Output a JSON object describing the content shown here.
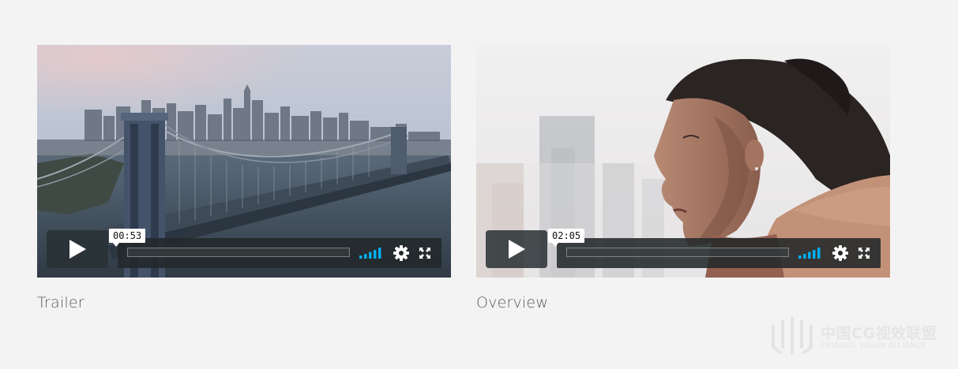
{
  "videos": [
    {
      "caption": "Trailer",
      "time_tooltip": "00:53",
      "progress": 0,
      "scene_description": "aerial-bridge-city-skyline",
      "controls": {
        "play_icon": "play-icon",
        "volume_icon": "volume-bars-icon",
        "settings_icon": "gear-icon",
        "fullscreen_icon": "fullscreen-icon"
      }
    },
    {
      "caption": "Overview",
      "time_tooltip": "02:05",
      "progress": 0,
      "scene_description": "woman-profile-blurred-city",
      "controls": {
        "play_icon": "play-icon",
        "volume_icon": "volume-bars-icon",
        "settings_icon": "gear-icon",
        "fullscreen_icon": "fullscreen-icon"
      }
    }
  ],
  "watermark": {
    "title": "中国CG视效联盟",
    "subtitle": "CHINACG VISION ALLIANCE"
  },
  "colors": {
    "background": "#f3f3f3",
    "accent": "#00adef",
    "control_bg": "#22282a",
    "caption_text": "#555a5e"
  }
}
